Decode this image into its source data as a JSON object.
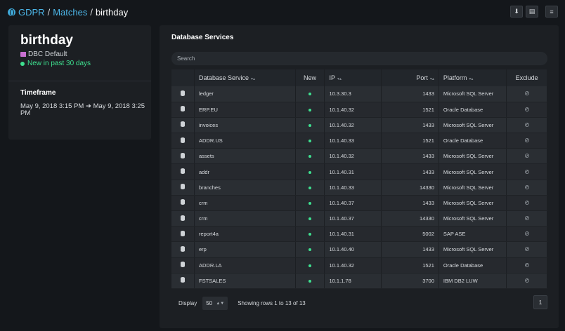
{
  "breadcrumb": {
    "root": "GDPR",
    "section": "Matches",
    "current": "birthday",
    "separator": "/"
  },
  "toolbar": {
    "icons": [
      "download-icon",
      "document-icon",
      "menu-icon"
    ],
    "download_glyph": "⬇",
    "document_glyph": "▤",
    "menu_glyph": "≡"
  },
  "summary": {
    "title": "birthday",
    "tag": "DBC Default",
    "status": "New in past 30 days",
    "tag_color": "#c86fd0",
    "status_color": "#3ee08f"
  },
  "timeframe": {
    "heading": "Timeframe",
    "start": "May 9, 2018 3:15 PM",
    "arrow": "➔",
    "end": "May 9, 2018 3:25 PM"
  },
  "services": {
    "heading": "Database Services",
    "search_placeholder": "Search",
    "columns": {
      "service": "Database Service",
      "new": "New",
      "ip": "IP",
      "port": "Port",
      "platform": "Platform",
      "exclude": "Exclude"
    },
    "sort_glyph": "▾▴",
    "rows": [
      {
        "service": "ledger",
        "ip": "10.3.30.3",
        "port": "1433",
        "platform": "Microsoft SQL Server"
      },
      {
        "service": "ERP.EU",
        "ip": "10.1.40.32",
        "port": "1521",
        "platform": "Oracle Database"
      },
      {
        "service": "invoices",
        "ip": "10.1.40.32",
        "port": "1433",
        "platform": "Microsoft SQL Server"
      },
      {
        "service": "ADDR.US",
        "ip": "10.1.40.33",
        "port": "1521",
        "platform": "Oracle Database"
      },
      {
        "service": "assets",
        "ip": "10.1.40.32",
        "port": "1433",
        "platform": "Microsoft SQL Server"
      },
      {
        "service": "addr",
        "ip": "10.1.40.31",
        "port": "1433",
        "platform": "Microsoft SQL Server"
      },
      {
        "service": "branches",
        "ip": "10.1.40.33",
        "port": "14330",
        "platform": "Microsoft SQL Server"
      },
      {
        "service": "crm",
        "ip": "10.1.40.37",
        "port": "1433",
        "platform": "Microsoft SQL Server"
      },
      {
        "service": "crm",
        "ip": "10.1.40.37",
        "port": "14330",
        "platform": "Microsoft SQL Server"
      },
      {
        "service": "report4a",
        "ip": "10.1.40.31",
        "port": "5002",
        "platform": "SAP ASE"
      },
      {
        "service": "erp",
        "ip": "10.1.40.40",
        "port": "1433",
        "platform": "Microsoft SQL Server"
      },
      {
        "service": "ADDR.LA",
        "ip": "10.1.40.32",
        "port": "1521",
        "platform": "Oracle Database"
      },
      {
        "service": "FSTSALES",
        "ip": "10.1.1.78",
        "port": "3700",
        "platform": "IBM DB2 LUW"
      }
    ]
  },
  "footer": {
    "display_label": "Display",
    "page_size": "50",
    "rows_info": "Showing rows 1 to 13 of 13",
    "page": "1"
  },
  "colors": {
    "accent": "#4cb6e8",
    "new_indicator": "#3ee08f",
    "background": "#14171b",
    "panel": "#1c1f23"
  }
}
